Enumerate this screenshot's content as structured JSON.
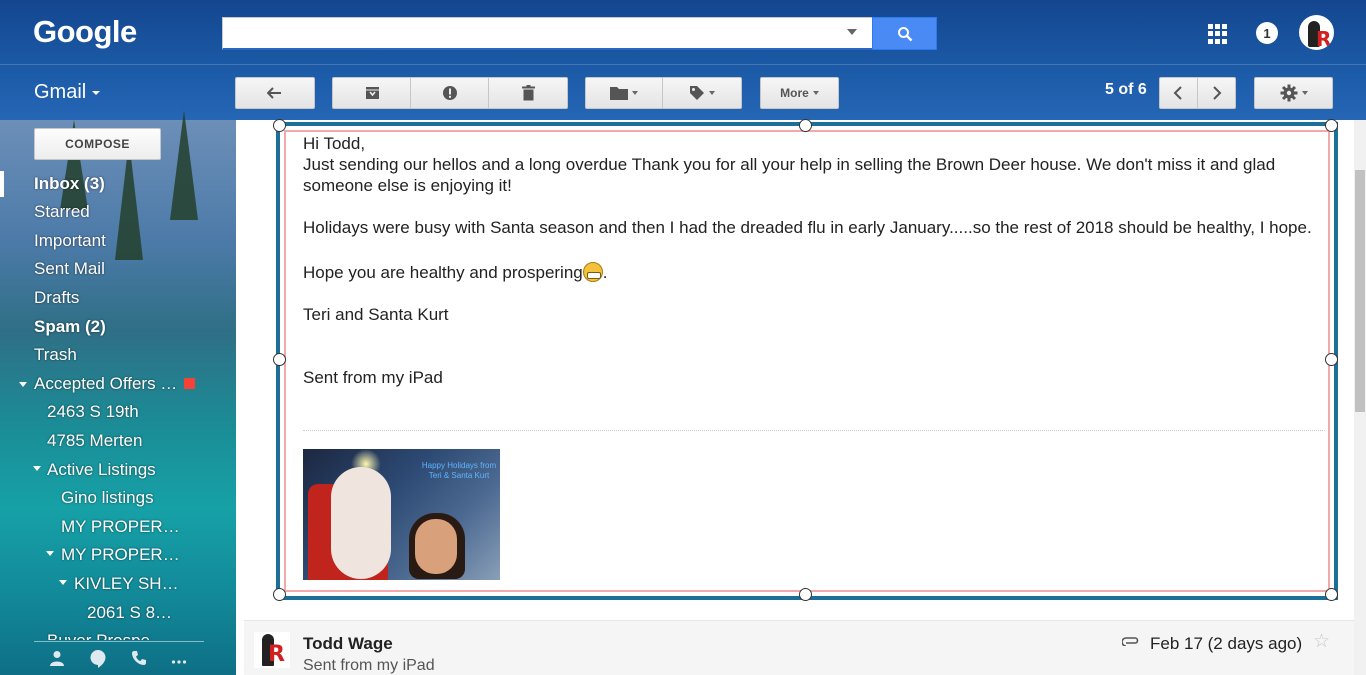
{
  "header": {
    "logo": "Google",
    "search_value": "",
    "notifications": "1"
  },
  "toolbar": {
    "app_label": "Gmail",
    "more_label": "More",
    "count": "5 of 6"
  },
  "sidebar": {
    "compose": "COMPOSE",
    "items": [
      {
        "label": "Inbox (3)"
      },
      {
        "label": "Starred"
      },
      {
        "label": "Important"
      },
      {
        "label": "Sent Mail"
      },
      {
        "label": "Drafts"
      },
      {
        "label": "Spam (2)"
      },
      {
        "label": "Trash"
      },
      {
        "label": "Accepted Offers …"
      },
      {
        "label": "2463 S 19th"
      },
      {
        "label": "4785 Merten"
      },
      {
        "label": "Active Listings"
      },
      {
        "label": "Gino listings"
      },
      {
        "label": "MY PROPER…"
      },
      {
        "label": "MY PROPER…"
      },
      {
        "label": "KIVLEY SH…"
      },
      {
        "label": "2061 S 8…"
      },
      {
        "label": "Buyer Prospe…"
      }
    ]
  },
  "message": {
    "greeting": "Hi Todd,",
    "line1": "Just sending our hellos and a long overdue Thank you for all your help in selling the Brown Deer house. We don't miss it and glad someone else is enjoying it!",
    "line2": "Holidays were busy with Santa season and then I had the dreaded flu in early January.....so the rest of 2018 should be healthy, I hope.",
    "line3": "Hope you are healthy and prospering",
    "line3_end": ".",
    "signature": "Teri and Santa Kurt",
    "sent_from": "Sent from my iPad",
    "photo_caption": "Happy Holidays from Teri & Santa Kurt"
  },
  "next_message": {
    "sender": "Todd Wage",
    "snippet": "Sent from my iPad",
    "date": "Feb 17 (2 days ago)"
  }
}
